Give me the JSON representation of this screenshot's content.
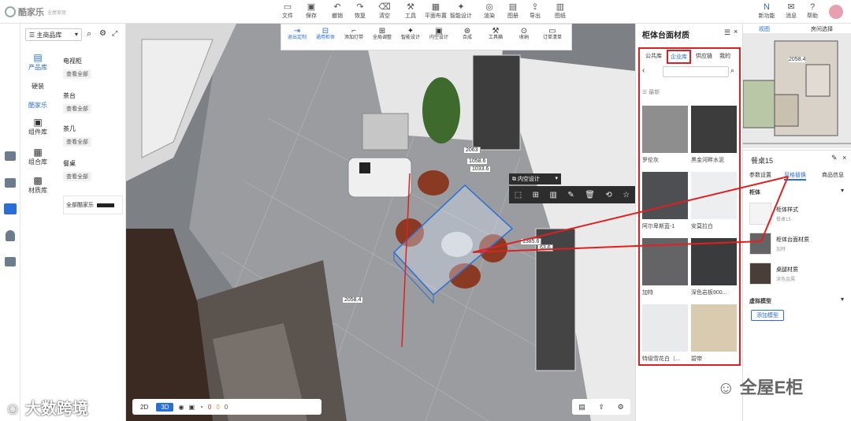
{
  "app": {
    "logo_text": "酷家乐",
    "logo_sub": "全屋家居"
  },
  "toolbar": {
    "items": [
      {
        "label": "文件",
        "icon": "file-icon"
      },
      {
        "label": "保存",
        "icon": "save-icon"
      },
      {
        "label": "撤销",
        "icon": "undo-icon"
      },
      {
        "label": "恢复",
        "icon": "redo-icon"
      },
      {
        "label": "清空",
        "icon": "clear-icon"
      },
      {
        "label": "工具",
        "icon": "tool-icon"
      },
      {
        "label": "平面布置",
        "icon": "floorplan-icon"
      },
      {
        "label": "智能设计",
        "icon": "smart-design-icon"
      },
      {
        "label": "渲染",
        "icon": "render-icon"
      },
      {
        "label": "图册",
        "icon": "album-icon"
      },
      {
        "label": "导出",
        "icon": "export-icon"
      },
      {
        "label": "图纸",
        "icon": "drawing-icon"
      }
    ],
    "right": [
      {
        "label": "新功能",
        "icon": "new-feature-icon"
      },
      {
        "label": "消息",
        "icon": "message-icon"
      },
      {
        "label": "帮助",
        "icon": "help-icon"
      }
    ]
  },
  "left_panel": {
    "library_select": "主商品库",
    "categories": [
      {
        "label": "产品库",
        "icon": "product-lib-icon"
      },
      {
        "label": "硬装",
        "icon": ""
      },
      {
        "label": "酷家乐",
        "icon": ""
      },
      {
        "label": "组件库",
        "icon": "component-icon"
      },
      {
        "label": "组合库",
        "icon": "group-icon"
      },
      {
        "label": "材质库",
        "icon": "material-icon"
      }
    ],
    "groups": [
      {
        "title": "电视柜",
        "button": "查看全部"
      },
      {
        "title": "茶台",
        "button": "查看全部"
      },
      {
        "title": "茶几",
        "button": "查看全部"
      },
      {
        "title": "餐桌",
        "button": "查看全部"
      }
    ],
    "bottom_item": "全部酷家乐"
  },
  "viewport": {
    "sub_toolbar": [
      "退出定制",
      "通用柜体",
      "添加灯带",
      "全局调整",
      "智能设计",
      "内空设计",
      "合成",
      "工具箱",
      "收纳",
      "订单清单"
    ],
    "context_label": "内空设计",
    "dims": [
      "2063",
      "1058.6",
      "1033.6",
      "1385.6",
      "63.6",
      "2058.4"
    ],
    "view_2d": "2D",
    "view_3d": "3D",
    "status_counts": [
      "0",
      "0",
      "0"
    ]
  },
  "material_panel": {
    "title": "柜体台面材质",
    "tabs": [
      "公共库",
      "企业库",
      "供应链",
      "我的"
    ],
    "active_tab": "企业库",
    "recent_label": "最新",
    "materials": [
      {
        "name": "罗伦灰",
        "color": "#8e8e8e"
      },
      {
        "name": "黑金河畔水泥",
        "color": "#3c3c3c"
      },
      {
        "name": "阿尔卑斯蓝-1",
        "color": "#4e4f52"
      },
      {
        "name": "安莫拉白",
        "color": "#eceef0"
      },
      {
        "name": "加特",
        "color": "#646466"
      },
      {
        "name": "深色岩板900...",
        "color": "#3a3b3d"
      },
      {
        "name": "特级雪花白（...",
        "color": "#e9eaec"
      },
      {
        "name": "碧带",
        "color": "#d8cbb0"
      }
    ]
  },
  "right_panel": {
    "tabs_top": [
      "视图",
      "房间选择"
    ],
    "plan_dims": [
      "2058.4"
    ],
    "object_name": "餐桌15",
    "obj_tabs": [
      "参数设置",
      "风格替换",
      "商品信息"
    ],
    "section_title": "柜体",
    "rows": [
      {
        "title": "柜体样式",
        "value": "餐桌15"
      },
      {
        "title": "柜体台面材质",
        "value": "加特"
      },
      {
        "title": "桌腿材质",
        "value": "深色金属"
      }
    ],
    "virtual_title": "虚拟模型",
    "add_button": "添加模型"
  },
  "watermarks": {
    "left": "大数跨境",
    "right": "全屋E柜"
  }
}
